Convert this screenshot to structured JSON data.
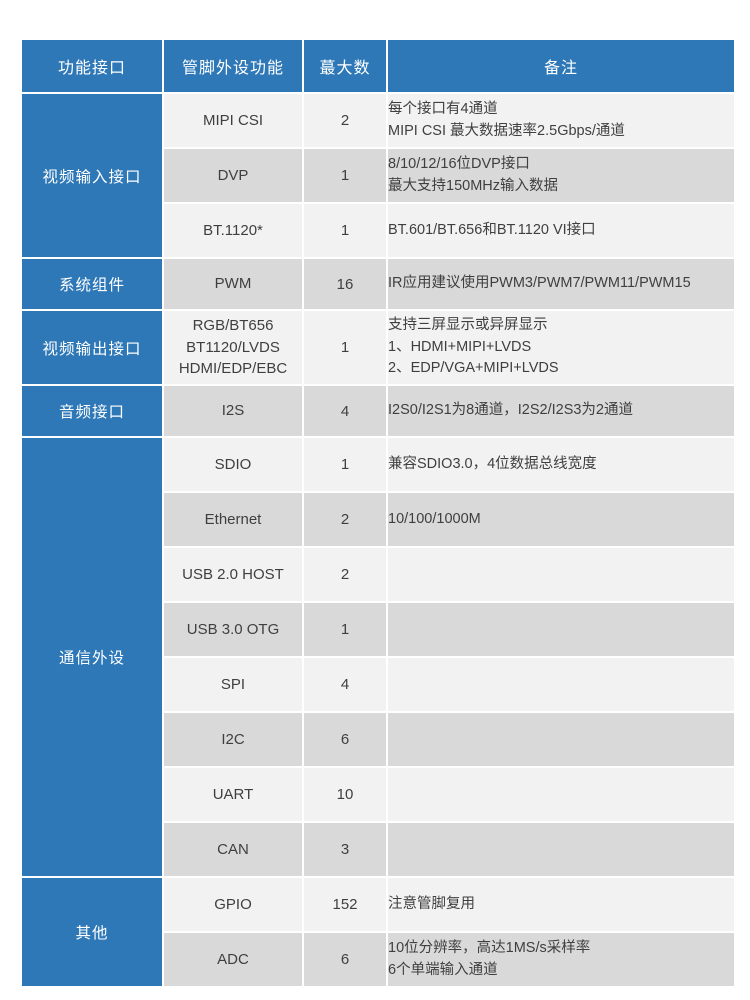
{
  "table": {
    "columns": [
      {
        "key": "interface",
        "label": "功能接口"
      },
      {
        "key": "pin_function",
        "label": "管脚外设功能"
      },
      {
        "key": "max_count",
        "label": "蕞大数"
      },
      {
        "key": "remark",
        "label": "备注"
      }
    ],
    "colors": {
      "header_bg": "#2E78B8",
      "group_bg": "#2E78B8",
      "header_text": "#FFFFFF",
      "row_light": "#F2F2F2",
      "row_dark": "#D9D9D9",
      "body_text": "#3F3F3F",
      "page_bg": "#FFFFFF"
    },
    "groups": [
      {
        "name": "视频输入接口",
        "rows": [
          {
            "pin_function": [
              "MIPI CSI"
            ],
            "max_count": "2",
            "remark": [
              "每个接口有4通道",
              "MIPI CSI 蕞大数据速率2.5Gbps/通道"
            ],
            "shade": "light"
          },
          {
            "pin_function": [
              "DVP"
            ],
            "max_count": "1",
            "remark": [
              "8/10/12/16位DVP接口",
              "蕞大支持150MHz输入数据"
            ],
            "shade": "dark"
          },
          {
            "pin_function": [
              "BT.1120*"
            ],
            "max_count": "1",
            "remark": [
              "BT.601/BT.656和BT.1120 VI接口"
            ],
            "shade": "light"
          }
        ]
      },
      {
        "name": "系统组件",
        "rows": [
          {
            "pin_function": [
              "PWM"
            ],
            "max_count": "16",
            "remark": [
              "IR应用建议使用PWM3/PWM7/PWM11/PWM15"
            ],
            "shade": "dark"
          }
        ]
      },
      {
        "name": "视频输出接口",
        "rows": [
          {
            "pin_function": [
              "RGB/BT656",
              "BT1120/LVDS",
              "HDMI/EDP/EBC"
            ],
            "max_count": "1",
            "remark": [
              "支持三屏显示或异屏显示",
              "1、HDMI+MIPI+LVDS",
              "2、EDP/VGA+MIPI+LVDS"
            ],
            "shade": "light"
          }
        ]
      },
      {
        "name": "音频接口",
        "rows": [
          {
            "pin_function": [
              "I2S"
            ],
            "max_count": "4",
            "remark": [
              "I2S0/I2S1为8通道，I2S2/I2S3为2通道"
            ],
            "shade": "dark"
          }
        ]
      },
      {
        "name": "通信外设",
        "rows": [
          {
            "pin_function": [
              "SDIO"
            ],
            "max_count": "1",
            "remark": [
              "兼容SDIO3.0，4位数据总线宽度"
            ],
            "shade": "light"
          },
          {
            "pin_function": [
              "Ethernet"
            ],
            "max_count": "2",
            "remark": [
              "10/100/1000M"
            ],
            "shade": "dark"
          },
          {
            "pin_function": [
              "USB 2.0 HOST"
            ],
            "max_count": "2",
            "remark": [
              ""
            ],
            "shade": "light"
          },
          {
            "pin_function": [
              "USB 3.0 OTG"
            ],
            "max_count": "1",
            "remark": [
              ""
            ],
            "shade": "dark"
          },
          {
            "pin_function": [
              "SPI"
            ],
            "max_count": "4",
            "remark": [
              ""
            ],
            "shade": "light"
          },
          {
            "pin_function": [
              "I2C"
            ],
            "max_count": "6",
            "remark": [
              ""
            ],
            "shade": "dark"
          },
          {
            "pin_function": [
              "UART"
            ],
            "max_count": "10",
            "remark": [
              ""
            ],
            "shade": "light"
          },
          {
            "pin_function": [
              "CAN"
            ],
            "max_count": "3",
            "remark": [
              ""
            ],
            "shade": "dark"
          }
        ]
      },
      {
        "name": "其他",
        "rows": [
          {
            "pin_function": [
              "GPIO"
            ],
            "max_count": "152",
            "remark": [
              "注意管脚复用"
            ],
            "shade": "light"
          },
          {
            "pin_function": [
              "ADC"
            ],
            "max_count": "6",
            "remark": [
              "10位分辨率，高达1MS/s采样率",
              "6个单端输入通道"
            ],
            "shade": "dark"
          }
        ]
      }
    ]
  }
}
